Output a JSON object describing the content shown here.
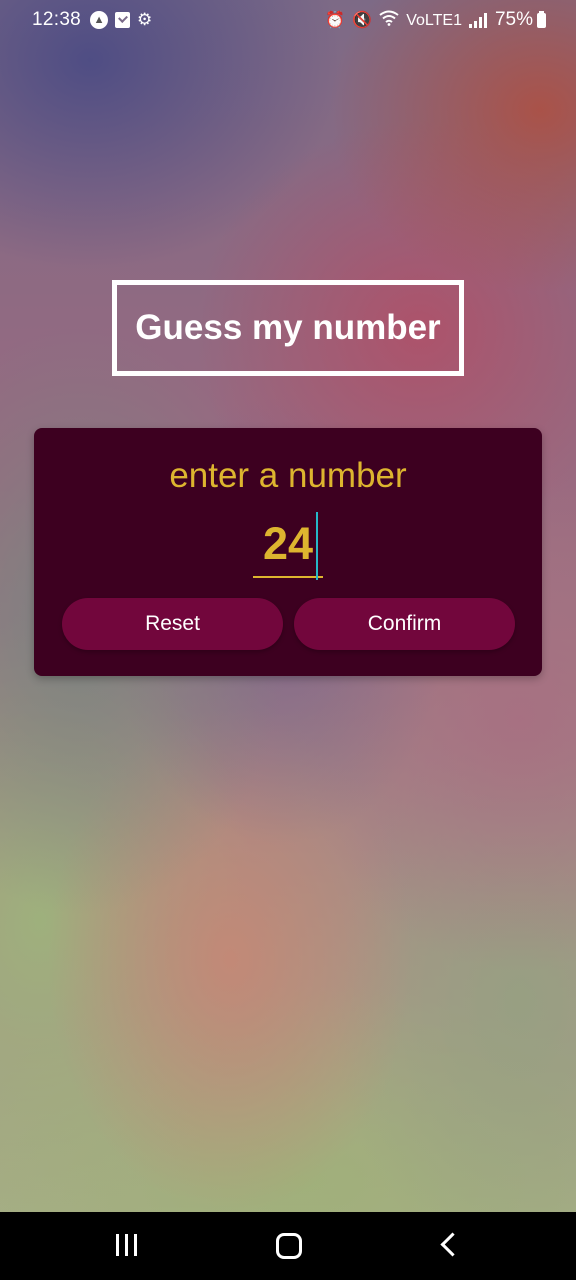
{
  "status_bar": {
    "time": "12:38",
    "left_icons": [
      "a-circle-icon",
      "checkbox-icon",
      "gear-icon"
    ],
    "right_icons": [
      "alarm-icon",
      "mute-icon",
      "wifi-icon",
      "volte-icon",
      "signal-icon"
    ],
    "volte_label": "VoLTE1",
    "battery_percent": "75%"
  },
  "app": {
    "title": "Guess my number",
    "prompt": "enter a number",
    "input_value": "24",
    "reset_label": "Reset",
    "confirm_label": "Confirm"
  },
  "colors": {
    "card_background": "#3d0020",
    "accent_gold": "#ddb52f",
    "button_background": "#72063c",
    "caret": "#26b8c8"
  },
  "nav_bar": {
    "buttons": [
      "recent-apps-icon",
      "home-icon",
      "back-icon"
    ]
  }
}
